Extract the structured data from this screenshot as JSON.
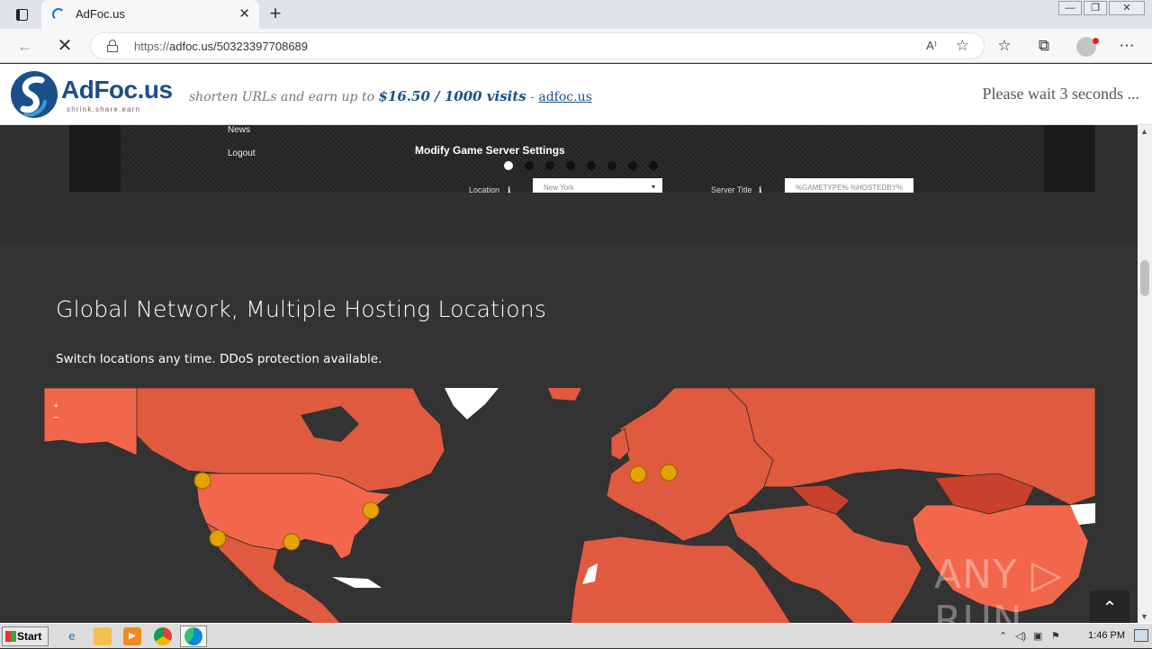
{
  "browser": {
    "tab_title": "AdFoc.us",
    "tab_close": "✕",
    "new_tab": "+",
    "url_prefix": "https://",
    "url_rest": "adfoc.us/50323397708689",
    "read_aloud": "A⁾",
    "minimize": "—",
    "restore": "❐",
    "close": "✕"
  },
  "adbar": {
    "logo_text": "AdFoc.us",
    "logo_tagline": "shrink.share.earn",
    "slogan_prefix": "shorten URLs and earn up to ",
    "slogan_price": "$16.50 / 1000 visits",
    "slogan_sep": " - ",
    "slogan_link": "adfoc.us",
    "wait_message": "Please wait 3 seconds ...",
    "accent_color": "#1a4f8b"
  },
  "hero": {
    "side_links": [
      "News",
      "Logout"
    ],
    "modify_title": "Modify Game Server Settings",
    "location_label": "Location",
    "location_value": "New York",
    "server_title_label": "Server Title",
    "server_title_value": "%GAMETYPE% %HOSTEDBY%",
    "carousel_count": 8,
    "carousel_active": 0
  },
  "section": {
    "title": "Global Network, Multiple Hosting Locations",
    "subtitle": "Switch locations any time. DDoS protection available."
  },
  "map": {
    "zoom_in": "+",
    "zoom_out": "−",
    "land_color": "#e05a40",
    "highlight_color": "#f2674b",
    "marker_color": "#e3a400",
    "markers": [
      "Seattle",
      "Los Angeles",
      "Dallas",
      "New York",
      "Paris",
      "Frankfurt"
    ]
  },
  "watermark": "ANY ▷ RUN",
  "to_top": "⌃",
  "taskbar": {
    "start_label": "Start",
    "clock": "1:46 PM"
  }
}
